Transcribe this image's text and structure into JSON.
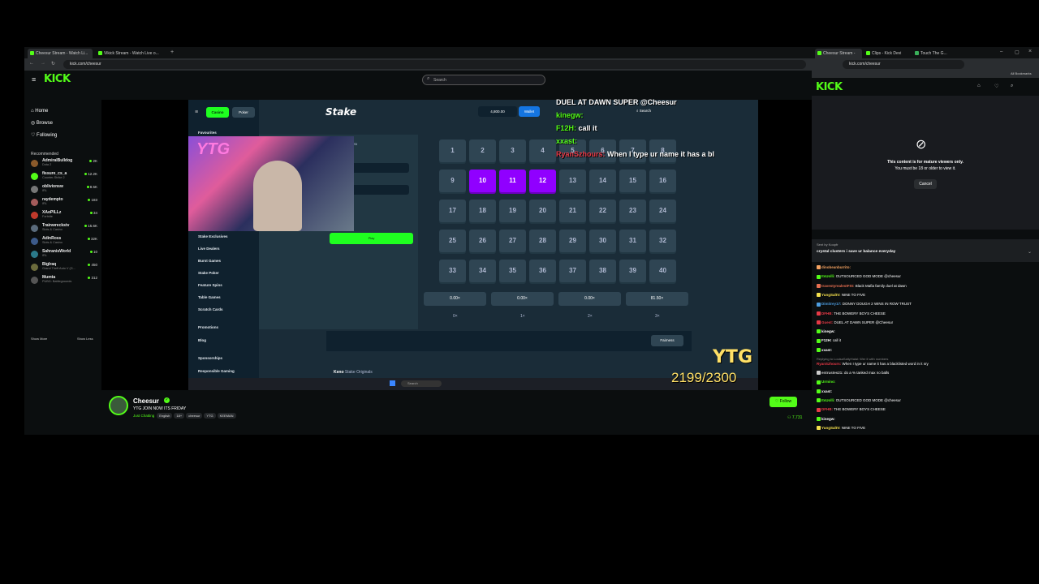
{
  "left_window": {
    "tabs": [
      {
        "label": "Cheesur Stream - Watch Li..."
      },
      {
        "label": "Vikick Stream - Watch Live o..."
      }
    ],
    "url": "kick.com/cheesur",
    "search_placeholder": "Search",
    "nav": [
      {
        "label": "Home",
        "icon": "home-icon"
      },
      {
        "label": "Browse",
        "icon": "compass-icon"
      },
      {
        "label": "Following",
        "icon": "heart-icon"
      }
    ],
    "recommended_title": "Recommended",
    "recommended": [
      {
        "name": "AdmiralBulldog",
        "game": "Dota 2",
        "viewers": "2K",
        "color": "#8a5a2b"
      },
      {
        "name": "fissure_cs_a",
        "game": "Counter-Strike 2",
        "viewers": "12.2K",
        "color": "#53fc18"
      },
      {
        "name": "oblivionsw",
        "game": "IRL",
        "viewers": "8.5K",
        "color": "#777777"
      },
      {
        "name": "raydempto",
        "game": "IRL",
        "viewers": "183",
        "color": "#a45b5b"
      },
      {
        "name": "XAoPILLz",
        "game": "Fortnite",
        "viewers": "34",
        "color": "#c0392b"
      },
      {
        "name": "Trainwreckstv",
        "game": "Slots & Casino",
        "viewers": "15.6K",
        "color": "#5a6b7c"
      },
      {
        "name": "AdinRoss",
        "game": "Slots & Casino",
        "viewers": "32K",
        "color": "#3c5a8a"
      },
      {
        "name": "SahranisWorld",
        "game": "IRL",
        "viewers": "10",
        "color": "#2b7a8a"
      },
      {
        "name": "BigIraq",
        "game": "Grand Theft Auto V (G...",
        "viewers": "450",
        "color": "#6b6b3c"
      },
      {
        "name": "Mumta",
        "game": "PUBG: Battlegrounds",
        "viewers": "312",
        "color": "#555555"
      }
    ],
    "show_more": "Show More",
    "show_less": "Show Less",
    "stake": {
      "logo": "Stake",
      "tabs": [
        "Casino",
        "Poker"
      ],
      "balance": "4,800.00",
      "wallet": "Wallet",
      "search": "Search",
      "favourites": "Favourites",
      "side_items": [
        "Stake Exclusives",
        "Live Dealers",
        "Burst Games",
        "Stake Poker",
        "Feature Spins",
        "Table Games",
        "Scratch Cards"
      ],
      "promotions": "Promotions",
      "blog": "Blog",
      "sponsorships": "Sponsorships",
      "responsible": "Responsible Gaming",
      "manual_tab": "Manual",
      "auto_tab": "Auto",
      "random_pick": "Random Pick",
      "clear_table": "Clear Table",
      "play": "Play",
      "tiles": [
        1,
        2,
        3,
        4,
        5,
        6,
        7,
        8,
        9,
        10,
        11,
        12,
        13,
        14,
        15,
        16,
        17,
        18,
        19,
        20,
        21,
        22,
        23,
        24,
        25,
        26,
        27,
        28,
        29,
        30,
        31,
        32,
        33,
        34,
        35,
        36,
        37,
        38,
        39,
        40
      ],
      "selected": [
        10,
        11,
        12
      ],
      "multipliers": [
        "0.00×",
        "0.00×",
        "0.00×",
        "81.50×"
      ],
      "hits": [
        "0×",
        "1×",
        "2×",
        "3×"
      ],
      "fairness": "Fairness",
      "game_title": "Keno",
      "game_sub": "Stake Originals",
      "taskbar_search": "Search"
    },
    "overlay_chat": [
      {
        "user": "",
        "text": "DUEL AT DAWN SUPER @Cheesur"
      },
      {
        "user": "kinegw:",
        "text": ""
      },
      {
        "user": "F12H:",
        "text": "call it"
      },
      {
        "user": "xxast:",
        "text": ""
      },
      {
        "user": "RyanSzhours:",
        "text": "When I type ur name it has a bl"
      }
    ],
    "overlay_logo": "YTG",
    "counter": "2199/2300",
    "streamer": {
      "name": "Cheesur",
      "title": "YTG JOIN NOW ITS FRIDAY",
      "category": "Just Chatting",
      "tags": [
        "English",
        "18+",
        "cheesur",
        "YTG",
        "KEEMAN"
      ],
      "viewers": "7,731",
      "follow": "Follow"
    }
  },
  "right_window": {
    "tabs": [
      {
        "label": "Cheesur Stream -"
      },
      {
        "label": "Clips - Kick Devi"
      },
      {
        "label": "Touch The G..."
      }
    ],
    "url": "kick.com/cheesur",
    "all_bookmarks": "All Bookmarks",
    "mature_title": "This content is for mature viewers only.",
    "mature_sub": "You must be 18 or older to view it.",
    "cancel": "Cancel",
    "pinned_user": "Sent by Koopfr",
    "pinned_text": "crystal clusters i save ur balance everyday",
    "chat": [
      {
        "user": "dinobeanburrito:",
        "text": "",
        "color": "#f4a261"
      },
      {
        "user": "ItsUolli:",
        "text": "OUTSOURCED GOD MODE @cheesur",
        "color": "#53fc18"
      },
      {
        "user": "travestyrealestFSt:",
        "text": "Black Mafia family duel at dawn",
        "color": "#e76f51"
      },
      {
        "user": "YungSaltV:",
        "text": "NINE TO FIVE",
        "color": "#f4e04d"
      },
      {
        "user": "Dimitrey17:",
        "text": "DONNY DOUGH 2 WINS IN ROW TRUST",
        "color": "#4d9de0"
      },
      {
        "user": "DFHB:",
        "text": "THE BOWERY BOYS CHEESE",
        "color": "#e63946"
      },
      {
        "user": "Guest:",
        "text": "DUEL AT DAWN SUPER @Cheesur",
        "color": "#e63946"
      },
      {
        "user": "kinegw:",
        "text": "",
        "color": "#ffffff"
      },
      {
        "user": "F12H:",
        "text": "call it",
        "color": "#ffffff"
      },
      {
        "user": "xxast:",
        "text": "",
        "color": "#ffffff"
      },
      {
        "user": "entrustes21:",
        "text": "do a % tanked max no balls",
        "color": "#cccccc"
      },
      {
        "user": "Urmino:",
        "text": "",
        "color": "#53fc18"
      },
      {
        "user": "xxast:",
        "text": "",
        "color": "#ffffff"
      },
      {
        "user": "ItsUolli:",
        "text": "OUTSOURCED GOD MODE @cheesur",
        "color": "#53fc18"
      },
      {
        "user": "DFHB:",
        "text": "THE BOWERY BOYS CHEESE",
        "color": "#e63946"
      },
      {
        "user": "kinegw:",
        "text": "",
        "color": "#ffffff"
      },
      {
        "user": "YungSaltV:",
        "text": "NINE TO FIVE",
        "color": "#f4e04d"
      }
    ],
    "reply_note": "Replying to LouisaSaltyHalal: Wer it with numbers",
    "reply_user": "RyanSzhours:",
    "reply_text": "When I type ur name it has a blacklisted word in it sry"
  },
  "colors": {
    "kick_green": "#53fc18",
    "keno_purple": "#9000ff",
    "stake_bg": "#1a2c38",
    "stake_green": "#1fff20"
  }
}
